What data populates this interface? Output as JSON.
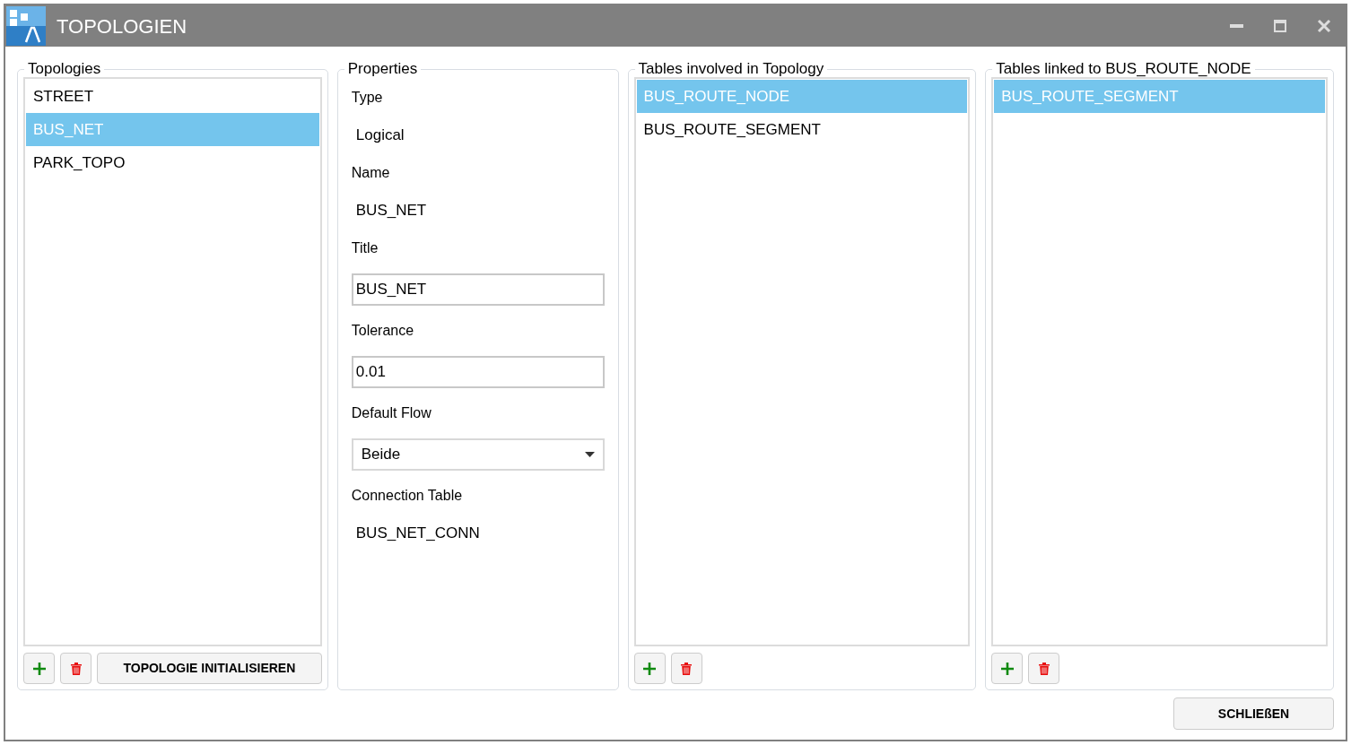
{
  "window": {
    "title": "TOPOLOGIEN"
  },
  "topologies": {
    "legend": "Topologies",
    "items": [
      {
        "label": "STREET",
        "selected": false
      },
      {
        "label": "BUS_NET",
        "selected": true
      },
      {
        "label": "PARK_TOPO",
        "selected": false
      }
    ],
    "init_button": "TOPOLOGIE INITIALISIEREN"
  },
  "properties": {
    "legend": "Properties",
    "fields": [
      {
        "kind": "static",
        "label": "Type",
        "value": "Logical"
      },
      {
        "kind": "static",
        "label": "Name",
        "value": "BUS_NET"
      },
      {
        "kind": "text",
        "label": "Title",
        "value": "BUS_NET"
      },
      {
        "kind": "text",
        "label": "Tolerance",
        "value": "0.01"
      },
      {
        "kind": "select",
        "label": "Default Flow",
        "value": "Beide"
      },
      {
        "kind": "static",
        "label": "Connection Table",
        "value": "BUS_NET_CONN"
      }
    ]
  },
  "involved_tables": {
    "legend": "Tables involved in Topology",
    "items": [
      {
        "label": "BUS_ROUTE_NODE",
        "selected": true
      },
      {
        "label": "BUS_ROUTE_SEGMENT",
        "selected": false
      }
    ]
  },
  "linked_tables": {
    "legend": "Tables linked to BUS_ROUTE_NODE",
    "items": [
      {
        "label": "BUS_ROUTE_SEGMENT",
        "selected": true
      }
    ]
  },
  "close_button": "SCHLIEßEN"
}
